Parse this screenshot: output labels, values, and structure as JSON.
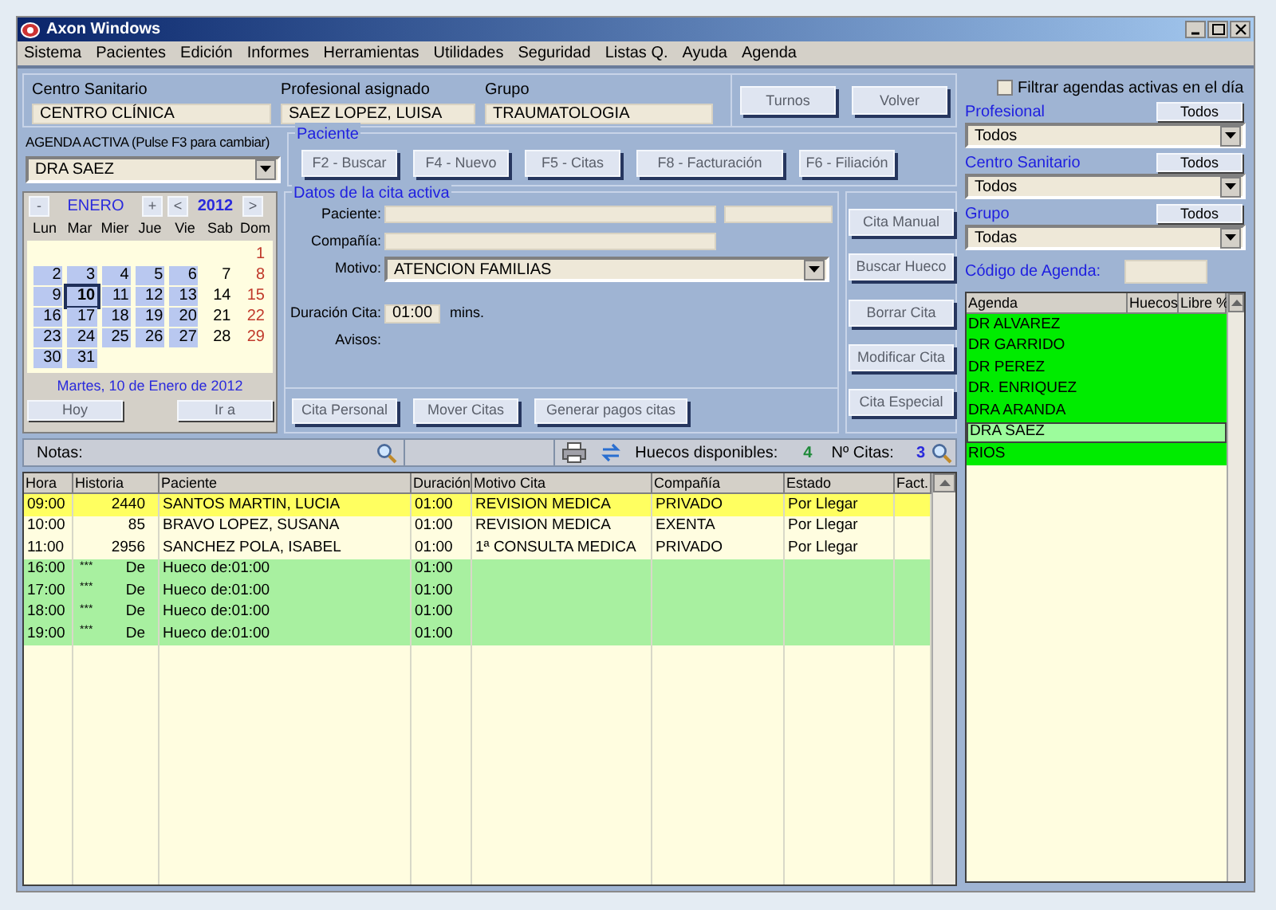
{
  "window": {
    "title": "Axon Windows"
  },
  "menu": [
    "Sistema",
    "Pacientes",
    "Edición",
    "Informes",
    "Herramientas",
    "Utilidades",
    "Seguridad",
    "Listas Q.",
    "Ayuda",
    "Agenda"
  ],
  "header": {
    "fields": [
      {
        "label": "Centro Sanitario",
        "value": "CENTRO CLÍNICA"
      },
      {
        "label": "Profesional asignado",
        "value": "SAEZ LOPEZ, LUISA"
      },
      {
        "label": "Grupo",
        "value": "TRAUMATOLOGIA"
      }
    ],
    "buttons": [
      "Turnos",
      "Volver"
    ]
  },
  "agenda_activa": {
    "label": "AGENDA ACTIVA (Pulse F3 para cambiar)",
    "value": "DRA SAEZ"
  },
  "paciente": {
    "title": "Paciente",
    "buttons": [
      "F2 - Buscar",
      "F4 - Nuevo",
      "F5 - Citas",
      "F8 - Facturación",
      "F6 - Filiación"
    ]
  },
  "calendar": {
    "month_prev": "-",
    "month": "ENERO",
    "month_next": "+",
    "year_prev": "<",
    "year": "2012",
    "year_next": ">",
    "weekdays": [
      "Lun",
      "Mar",
      "Mier",
      "Jue",
      "Vie",
      "Sab",
      "Dom"
    ],
    "weeks": [
      [
        {
          "day": "1",
          "marked": false,
          "selected": false
        }
      ],
      [
        {
          "day": "2",
          "marked": true,
          "selected": false
        },
        {
          "day": "3",
          "marked": true,
          "selected": false
        },
        {
          "day": "4",
          "marked": true,
          "selected": false
        },
        {
          "day": "5",
          "marked": true,
          "selected": false
        },
        {
          "day": "6",
          "marked": true,
          "selected": false
        },
        {
          "day": "7",
          "marked": false,
          "selected": false
        },
        {
          "day": "8",
          "marked": false,
          "selected": false
        }
      ],
      [
        {
          "day": "9",
          "marked": true,
          "selected": false
        },
        {
          "day": "10",
          "marked": true,
          "selected": true
        },
        {
          "day": "11",
          "marked": true,
          "selected": false
        },
        {
          "day": "12",
          "marked": true,
          "selected": false
        },
        {
          "day": "13",
          "marked": true,
          "selected": false
        },
        {
          "day": "14",
          "marked": false,
          "selected": false
        },
        {
          "day": "15",
          "marked": false,
          "selected": false
        }
      ],
      [
        {
          "day": "16",
          "marked": true,
          "selected": false
        },
        {
          "day": "17",
          "marked": true,
          "selected": false
        },
        {
          "day": "18",
          "marked": true,
          "selected": false
        },
        {
          "day": "19",
          "marked": true,
          "selected": false
        },
        {
          "day": "20",
          "marked": true,
          "selected": false
        },
        {
          "day": "21",
          "marked": false,
          "selected": false
        },
        {
          "day": "22",
          "marked": false,
          "selected": false
        }
      ],
      [
        {
          "day": "23",
          "marked": true,
          "selected": false
        },
        {
          "day": "24",
          "marked": true,
          "selected": false
        },
        {
          "day": "25",
          "marked": true,
          "selected": false
        },
        {
          "day": "26",
          "marked": true,
          "selected": false
        },
        {
          "day": "27",
          "marked": true,
          "selected": false
        },
        {
          "day": "28",
          "marked": false,
          "selected": false
        },
        {
          "day": "29",
          "marked": false,
          "selected": false
        }
      ],
      [
        {
          "day": "30",
          "marked": true,
          "selected": false
        },
        {
          "day": "31",
          "marked": true,
          "selected": false
        }
      ]
    ],
    "caption": "Martes, 10 de Enero de 2012",
    "buttons": [
      "Hoy",
      "Ir a"
    ]
  },
  "datos": {
    "title": "Datos de la cita activa",
    "paciente_label": "Paciente:",
    "compania_label": "Compañía:",
    "motivo_label": "Motivo:",
    "motivo": "ATENCION FAMILIAS",
    "duracion_label": "Duración Cita:",
    "duracion": "01:00",
    "duracion_unit": "mins.",
    "avisos_label": "Avisos:"
  },
  "side_buttons": [
    "Cita Manual",
    "Buscar Hueco",
    "Borrar Cita",
    "Modificar Cita",
    "Cita Especial"
  ],
  "bottom_buttons": [
    "Cita Personal",
    "Mover Citas",
    "Generar pagos citas"
  ],
  "toolbar": {
    "notas": "Notas:",
    "huecos_label": "Huecos disponibles:",
    "huecos": "4",
    "citas_label": "Nº Citas:",
    "citas": "3"
  },
  "table": {
    "columns": [
      "Hora",
      "Historia",
      "Paciente",
      "Duración",
      "Motivo Cita",
      "Compañía",
      "Estado",
      "Fact."
    ],
    "rows": [
      {
        "kind": "cita",
        "selected": true,
        "hora": "09:00",
        "historia": "2440",
        "paciente": "SANTOS MARTIN, LUCIA",
        "duracion": "01:00",
        "motivo": "REVISION MEDICA",
        "compania": "PRIVADO",
        "estado": "Por Llegar"
      },
      {
        "kind": "cita",
        "selected": false,
        "hora": "10:00",
        "historia": "85",
        "paciente": "BRAVO LOPEZ, SUSANA",
        "duracion": "01:00",
        "motivo": "REVISION MEDICA",
        "compania": "EXENTA",
        "estado": "Por Llegar"
      },
      {
        "kind": "cita",
        "selected": false,
        "hora": "11:00",
        "historia": "2956",
        "paciente": "SANCHEZ POLA, ISABEL",
        "duracion": "01:00",
        "motivo": "1ª CONSULTA MEDICA",
        "compania": "PRIVADO",
        "estado": "Por Llegar"
      },
      {
        "kind": "hueco",
        "selected": false,
        "hora": "16:00",
        "flag": "***",
        "historia": "De",
        "paciente": "Hueco de:01:00",
        "duracion": "01:00"
      },
      {
        "kind": "hueco",
        "selected": false,
        "hora": "17:00",
        "flag": "***",
        "historia": "De",
        "paciente": "Hueco de:01:00",
        "duracion": "01:00"
      },
      {
        "kind": "hueco",
        "selected": false,
        "hora": "18:00",
        "flag": "***",
        "historia": "De",
        "paciente": "Hueco de:01:00",
        "duracion": "01:00"
      },
      {
        "kind": "hueco",
        "selected": false,
        "hora": "19:00",
        "flag": "***",
        "historia": "De",
        "paciente": "Hueco de:01:00",
        "duracion": "01:00"
      }
    ]
  },
  "right": {
    "filter": {
      "label": "Filtrar agendas activas en el día",
      "checked": false
    },
    "filters": [
      {
        "label": "Profesional",
        "button": "Todos",
        "value": "Todos"
      },
      {
        "label": "Centro Sanitario",
        "button": "Todos",
        "value": "Todos"
      },
      {
        "label": "Grupo",
        "button": "Todos",
        "value": "Todas"
      }
    ],
    "codigo_label": "Código de Agenda:",
    "table": {
      "columns": [
        "Agenda",
        "Huecos",
        "Libre %"
      ],
      "rows": [
        {
          "name": "DR ALVAREZ",
          "selected": false
        },
        {
          "name": "DR GARRIDO",
          "selected": false
        },
        {
          "name": "DR PEREZ",
          "selected": false
        },
        {
          "name": "DR. ENRIQUEZ",
          "selected": false
        },
        {
          "name": "DRA ARANDA",
          "selected": false
        },
        {
          "name": "DRA SAEZ",
          "selected": true
        },
        {
          "name": "RIOS",
          "selected": false
        }
      ]
    }
  }
}
